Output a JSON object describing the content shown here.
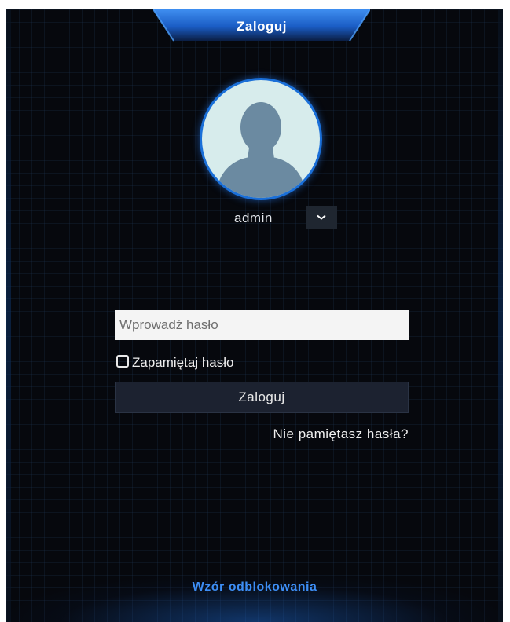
{
  "dialog": {
    "title": "Zaloguj"
  },
  "user": {
    "name": "admin",
    "avatar_icon": "user-silhouette-icon",
    "dropdown_icon": "chevron-down-icon"
  },
  "form": {
    "password_placeholder": "Wprowadź hasło",
    "password_value": "",
    "remember_label": "Zapamiętaj hasło",
    "remember_checked": false,
    "login_label": "Zaloguj",
    "forgot_label": "Nie pamiętasz hasła?"
  },
  "footer": {
    "unlock_pattern_label": "Wzór odblokowania"
  },
  "colors": {
    "accent": "#1a6fd8",
    "link": "#3d8ef5",
    "background": "#06080d"
  }
}
